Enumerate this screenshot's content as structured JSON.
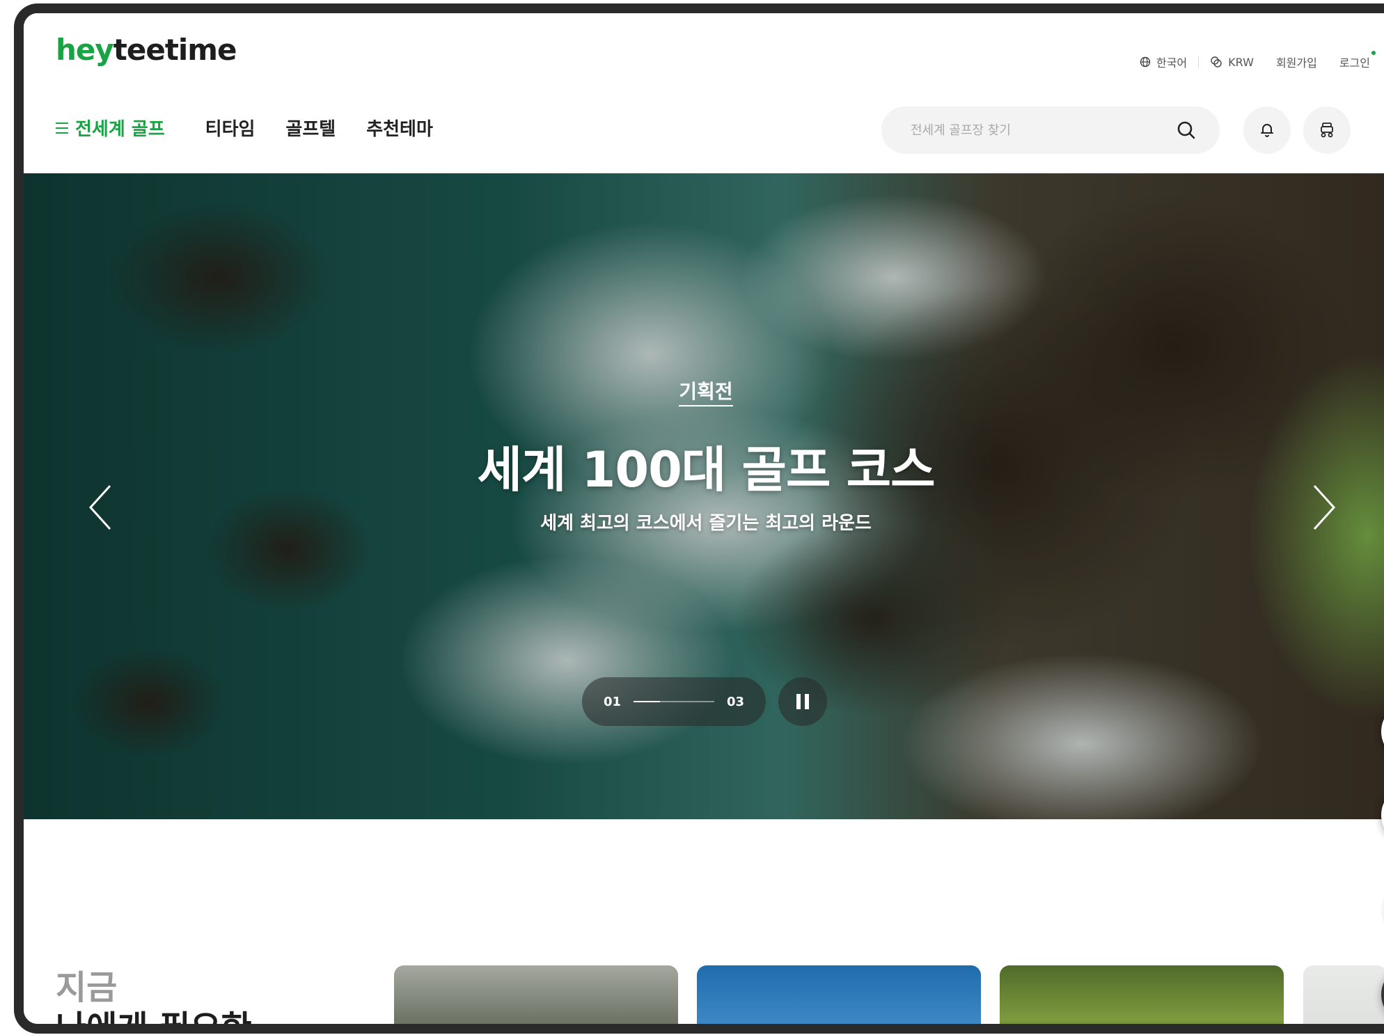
{
  "brand": {
    "logo_part1": "hey",
    "logo_part2": "teetime",
    "primary_color": "#18a442"
  },
  "util_nav": {
    "language": "한국어",
    "currency": "KRW",
    "signup": "회원가입",
    "login": "로그인"
  },
  "main_nav": {
    "global_golf": "전세계 골프",
    "items": [
      "티타임",
      "골프텔",
      "추천테마"
    ]
  },
  "search": {
    "placeholder": "전세계 골프장 찾기"
  },
  "hero": {
    "label": "기획전",
    "title": "세계 100대 골프 코스",
    "subtitle": "세계 최고의 코스에서 즐기는 최고의 라운드",
    "pager_current": "01",
    "pager_total": "03",
    "progress": 0.33
  },
  "section": {
    "title_line1": "지금",
    "title_line2": "나에게 필요한"
  }
}
